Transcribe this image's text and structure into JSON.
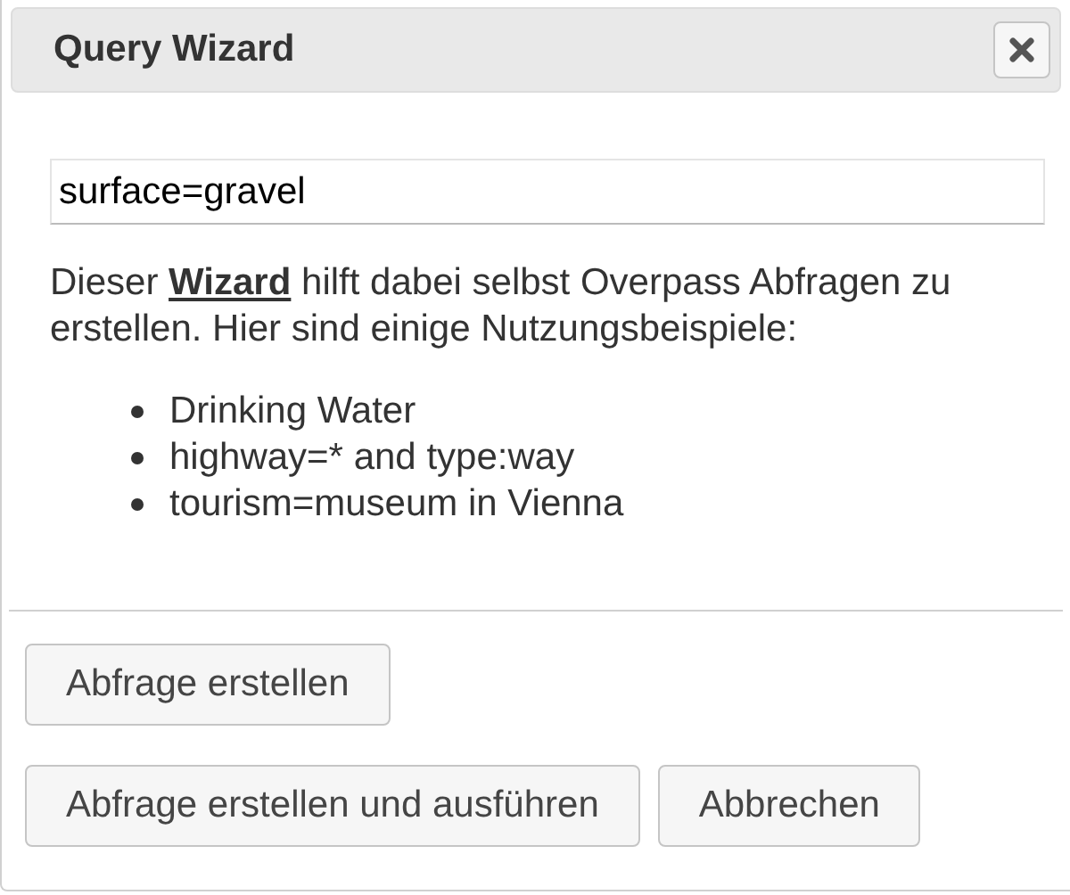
{
  "dialog": {
    "title": "Query Wizard"
  },
  "query_field": {
    "value": "surface=gravel"
  },
  "description": {
    "before": "Dieser",
    "link": "Wizard",
    "after": "hilft dabei selbst Overpass Abfragen zu erstellen. Hier sind einige Nutzungsbeispiele:"
  },
  "examples": [
    "Drinking Water",
    "highway=* and type:way",
    "tourism=museum in Vienna"
  ],
  "button_rows": [
    [
      "Abfrage erstellen"
    ],
    [
      "Abfrage erstellen und ausführen",
      "Abbrechen"
    ]
  ]
}
